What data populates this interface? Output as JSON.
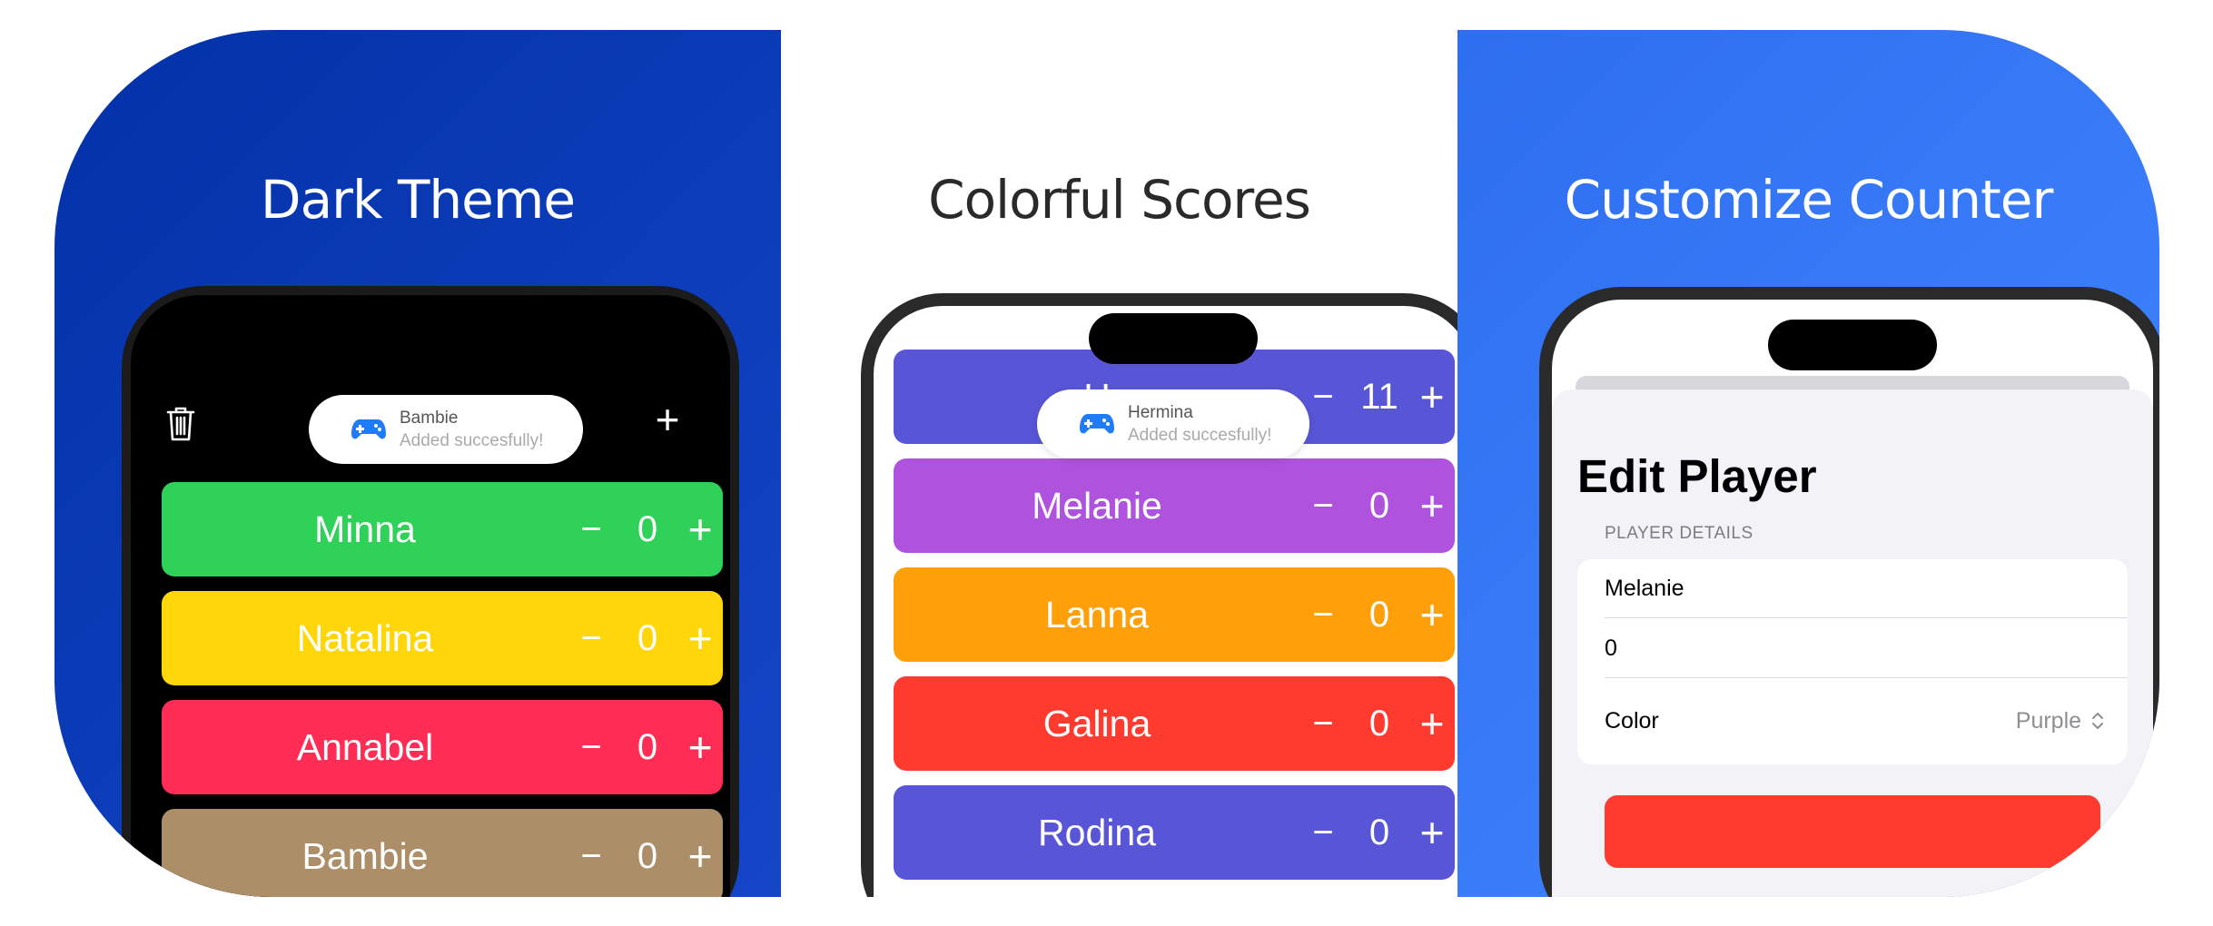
{
  "panels": [
    {
      "title": "Dark Theme",
      "background": "#0b3bb8"
    },
    {
      "title": "Colorful Scores",
      "background": "#ffffff"
    },
    {
      "title": "Customize Counter",
      "background": "#3a7df5"
    }
  ],
  "dark_phone": {
    "toast": {
      "title": "Bambie",
      "subtitle": "Added succesfully!"
    },
    "icons": {
      "left": "trash-icon",
      "right": "plus-icon"
    },
    "add_label": "+",
    "players": [
      {
        "name": "Minna",
        "score": "0",
        "color": "#30d158"
      },
      {
        "name": "Natalina",
        "score": "0",
        "color": "#ffd60a"
      },
      {
        "name": "Annabel",
        "score": "0",
        "color": "#ff2d55"
      },
      {
        "name": "Bambie",
        "score": "0",
        "color": "#ac8e68"
      }
    ]
  },
  "colorful_phone": {
    "toast": {
      "title": "Hermina",
      "subtitle": "Added succesfully!"
    },
    "players": [
      {
        "name": "H",
        "score": "11",
        "color": "#5856d6"
      },
      {
        "name": "Melanie",
        "score": "0",
        "color": "#af52de"
      },
      {
        "name": "Lanna",
        "score": "0",
        "color": "#ff9f0a"
      },
      {
        "name": "Galina",
        "score": "0",
        "color": "#ff3b30"
      },
      {
        "name": "Rodina",
        "score": "0",
        "color": "#5856d6"
      }
    ]
  },
  "counter_controls": {
    "minus": "−",
    "plus": "+"
  },
  "edit_phone": {
    "title": "Edit Player",
    "section": "PLAYER DETAILS",
    "name_value": "Melanie",
    "score_value": "0",
    "color_label": "Color",
    "color_value": "Purple",
    "color_picker_icon": "chevron-up-down-icon",
    "delete_button_color": "#ff3b30"
  }
}
